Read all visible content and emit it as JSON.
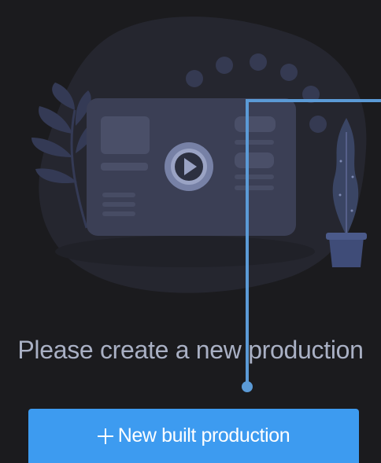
{
  "empty_state": {
    "message": "Please create a new production",
    "illustration_icon": "video-play-illustration-icon"
  },
  "actions": {
    "new_button_label": "New built production",
    "new_button_icon": "plus-icon"
  },
  "colors": {
    "background": "#1b1b1e",
    "accent": "#3d9bf0",
    "message_text": "#a9b0c4",
    "callout": "#5b9ad6"
  }
}
